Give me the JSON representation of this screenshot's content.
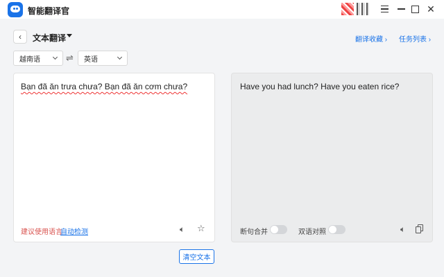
{
  "app": {
    "title": "智能翻译官"
  },
  "header": {
    "back_icon": "chevron-left-icon",
    "title": "文本翻译",
    "links": {
      "favorites": "翻译收藏 ›",
      "tasks": "任务列表 ›"
    }
  },
  "languages": {
    "source": "越南语",
    "target": "英语",
    "swap_icon": "swap-arrows-icon"
  },
  "source_panel": {
    "text": "Bạn đã ăn trưa chưa? Bạn đã ăn cơm chưa?",
    "suggest_label": "建议使用语言",
    "autodetect_label": "自动检测",
    "icons": [
      "speaker-icon",
      "star-icon"
    ]
  },
  "target_panel": {
    "text": "Have you had lunch? Have you eaten rice?",
    "option_sentence_merge": "断句合并",
    "option_bilingual": "双语对照",
    "sentence_merge_on": false,
    "bilingual_on": false,
    "icons": [
      "speaker-icon",
      "copy-icon"
    ]
  },
  "actions": {
    "clear": "清空文本"
  },
  "colors": {
    "accent": "#1a73e8",
    "warning": "#d9534f",
    "background": "#f3f4f6"
  }
}
